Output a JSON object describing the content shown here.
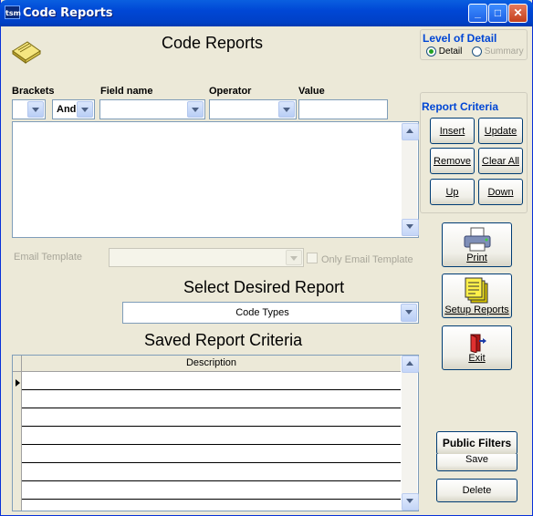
{
  "window": {
    "title": "Code Reports",
    "icon_text": "tsm"
  },
  "header": {
    "title": "Code Reports"
  },
  "level_of_detail": {
    "title": "Level of Detail",
    "detail_label": "Detail",
    "summary_label": "Summary",
    "selected": "Detail"
  },
  "filter": {
    "brackets_label": "Brackets",
    "field_name_label": "Field name",
    "operator_label": "Operator",
    "value_label": "Value",
    "brackets_value": "",
    "and_value": "And",
    "field_name_value": "",
    "operator_value": "",
    "value_value": ""
  },
  "report_criteria": {
    "title": "Report Criteria",
    "insert": "Insert",
    "update": "Update",
    "remove": "Remove",
    "clear_all": "Clear All",
    "up": "Up",
    "down": "Down"
  },
  "email": {
    "template_label": "Email Template",
    "template_value": "",
    "only_email_template_label": "Only Email Template",
    "only_checked": false
  },
  "select_report": {
    "title": "Select Desired Report",
    "value": "Code Types"
  },
  "saved": {
    "title": "Saved Report Criteria",
    "column_description": "Description",
    "rows": [
      "",
      "",
      "",
      "",
      "",
      "",
      "",
      ""
    ]
  },
  "side_buttons": {
    "print": "Print",
    "setup_reports": "Setup Reports",
    "exit": "Exit"
  },
  "bottom_buttons": {
    "public_filters": "Public Filters",
    "save": "Save",
    "delete": "Delete"
  },
  "colors": {
    "title_bar": "#0a5fe0",
    "dialog_bg": "#ece9d8",
    "group_title": "#0046d5"
  }
}
